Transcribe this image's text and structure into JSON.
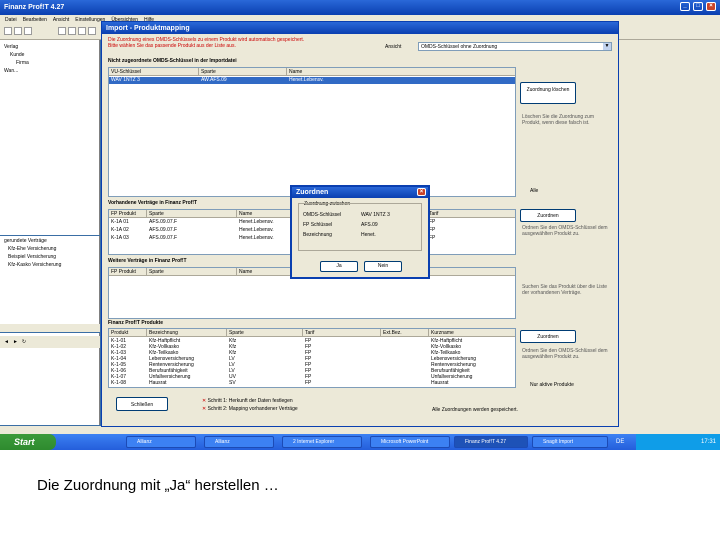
{
  "app": {
    "title": "Finanz Prof!T 4.27",
    "menu": [
      "Datei",
      "Bearbeiten",
      "Ansicht",
      "Einstellungen",
      "Übersichten",
      "Hilfe"
    ]
  },
  "left_panel": {
    "tree": [
      "Verlag",
      "Kunde",
      "Firma",
      "Wan..."
    ],
    "section_label": "gerundete Verträge",
    "items": [
      "Kfz-Ehe Versicherung",
      "Beispiel Versicherung",
      "Kfz-Kasko Versicherung"
    ]
  },
  "import_dialog": {
    "title": "Import - Produktmapping",
    "red_lines": [
      "Die Zuordnung eines OMDS-Schlüssels zu einem Produkt wird automatisch gespeichert.",
      "Bitte wählen Sie das passende Produkt aus der Liste aus."
    ],
    "filter_label": "Ansicht",
    "filter_value": "OMDS-Schlüssel ohne Zuordnung",
    "section1": {
      "label": "Nicht zugeordnete OMDS-Schlüssel in der Importdatei",
      "columns": [
        "VU-Schlüssel",
        "Sparte",
        "Name"
      ],
      "rows": [
        [
          "WAV 1NTZ 3",
          "AW.AFS.09",
          "Henet.Lebensv."
        ]
      ]
    },
    "btn_zuordnung_loeschen": "Zuordnung löschen",
    "notes1": "Löschen Sie die Zuordnung zum Produkt, wenn diese falsch ist.",
    "checkbox_label": "Alle",
    "section2": {
      "label": "Vorhandene Verträge in Finanz Prof!T",
      "columns": [
        "FP Produkt",
        "Sparte",
        "Name",
        "Tarif"
      ],
      "rows": [
        [
          "K-1A 01",
          "AFS.09.07.F",
          "Henet.Lebensv.",
          "FP"
        ],
        [
          "K-1A 02",
          "AFS.09.07.F",
          "Henet.Lebensv.",
          "FP"
        ],
        [
          "K-1A 03",
          "AFS.09.07.F",
          "Henet.Lebensv.",
          "FP"
        ]
      ]
    },
    "btn_zuordnen": "Zuordnen",
    "notes2": "Ordnen Sie den OMDS-Schlüssel dem ausgewählten Produkt zu.",
    "section3": {
      "label": "Weitere Verträge in Finanz Prof!T",
      "columns": [
        "FP Produkt",
        "Sparte",
        "Name"
      ],
      "rows": []
    },
    "notes3": "Suchen Sie das Produkt über die Liste der vorhandenen Verträge.",
    "section4": {
      "label": "Finanz Prof!T Produkte",
      "columns": [
        "Produkt",
        "Bezeichnung",
        "Sparte",
        "Tarif",
        "Ext.Bez.",
        "Kurzname"
      ],
      "rows": [
        [
          "K-1-01",
          "Kfz-Haftpflicht",
          "Kfz",
          "FP",
          "",
          "Kfz-Haftpflicht"
        ],
        [
          "K-1-02",
          "Kfz-Vollkasko",
          "Kfz",
          "FP",
          "",
          "Kfz-Vollkasko"
        ],
        [
          "K-1-03",
          "Kfz-Teilkasko",
          "Kfz",
          "FP",
          "",
          "Kfz-Teilkasko"
        ],
        [
          "K-1-04",
          "Lebensversicherung",
          "LV",
          "FP",
          "",
          "Lebensversicherung"
        ],
        [
          "K-1-05",
          "Rentenversicherung",
          "LV",
          "FP",
          "",
          "Rentenversicherung"
        ],
        [
          "K-1-06",
          "Berufsunfähigkeit",
          "LV",
          "FP",
          "",
          "Berufsunfähigkeit"
        ],
        [
          "K-1-07",
          "Unfallversicherung",
          "UV",
          "FP",
          "",
          "Unfallversicherung"
        ],
        [
          "K-1-08",
          "Hausrat",
          "SV",
          "FP",
          "",
          "Hausrat"
        ]
      ]
    },
    "btn_zuordnen2": "Zuordnen",
    "notes4": "Ordnen Sie den OMDS-Schlüssel dem ausgewählten Produkt zu.",
    "checkbox2_label": "Nur aktive Produkte",
    "btn_schliessen": "Schließen",
    "steps": [
      "Schritt 1: Herkunft der Daten festlegen",
      "Schritt 2: Mapping vorhandener Verträge"
    ],
    "bottom_note": "Alle Zuordnungen werden gespeichert."
  },
  "zuordnen_dialog": {
    "title": "Zuordnen",
    "group_label": "Zuordnung zwischen",
    "left_col": [
      "OMDS-Schlüssel",
      "FP Schlüssel",
      "Bezeichnung"
    ],
    "right_col": [
      "WAV 1NTZ 3",
      "AFS.09",
      "Henet."
    ],
    "btn_ja": "Ja",
    "btn_nein": "Nein"
  },
  "taskbar": {
    "start": "Start",
    "tasks": [
      "Allianz",
      "Allianz",
      "2 Internet Explorer",
      "Microsoft PowerPoint",
      "Finanz Prof!T 4.27",
      "SnagIt Import"
    ],
    "lang": "DE",
    "time": "17:31"
  },
  "caption": "Die Zuordnung mit „Ja“ herstellen …"
}
